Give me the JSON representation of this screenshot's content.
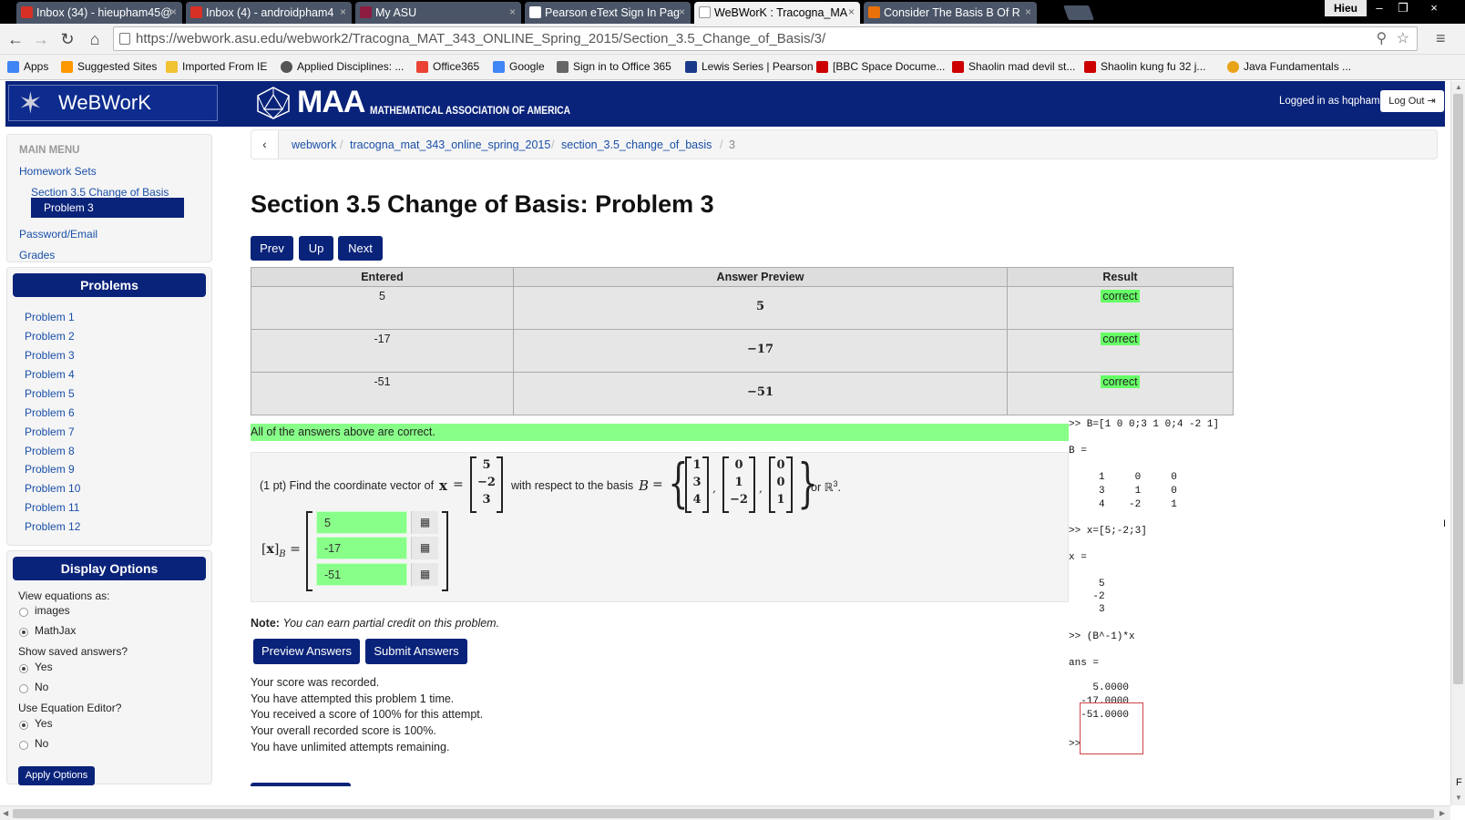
{
  "browser": {
    "tabs": [
      {
        "title": "Inbox (34) - hieupham45@",
        "favicon_color": "#d93025"
      },
      {
        "title": "Inbox (4) - androidpham4",
        "favicon_color": "#d93025"
      },
      {
        "title": "My ASU",
        "favicon_color": "#8c1d40"
      },
      {
        "title": "Pearson eText Sign In Pag",
        "favicon_color": "#ffffff"
      },
      {
        "title": "WeBWorK : Tracogna_MA",
        "favicon_color": "#ffffff"
      },
      {
        "title": "Consider The Basis B Of R",
        "favicon_color": "#e8710a"
      }
    ],
    "user": "Hieu",
    "url": "https://webwork.asu.edu/webwork2/Tracogna_MAT_343_ONLINE_Spring_2015/Section_3.5_Change_of_Basis/3/",
    "bookmarks": [
      {
        "label": "Apps",
        "color": "#4285f4"
      },
      {
        "label": "Suggested Sites",
        "color": "#ff9800"
      },
      {
        "label": "Imported From IE",
        "color": "#f1c232"
      },
      {
        "label": "Applied Disciplines: ...",
        "color": "#555555"
      },
      {
        "label": "Office365",
        "color": "#ea4335"
      },
      {
        "label": "Google",
        "color": "#4285f4"
      },
      {
        "label": "Sign in to Office 365",
        "color": "#666666"
      },
      {
        "label": "Lewis Series | Pearson",
        "color": "#1a3a8a"
      },
      {
        "label": "[BBC Space Docume...",
        "color": "#cc0000"
      },
      {
        "label": "Shaolin mad devil st...",
        "color": "#cc0000"
      },
      {
        "label": "Shaolin kung fu 32 j...",
        "color": "#cc0000"
      },
      {
        "label": "Java Fundamentals ...",
        "color": "#e8a317"
      }
    ]
  },
  "header": {
    "logo": "WeBWorK",
    "maa_big": "MAA",
    "maa_small": "MATHEMATICAL ASSOCIATION OF AMERICA",
    "logged_in": "Logged in as hqpham.",
    "logout": "Log Out"
  },
  "sidebar": {
    "main_menu_title": "MAIN MENU",
    "homework_sets": "Homework Sets",
    "section": "Section 3.5 Change of Basis",
    "current_problem": "Problem 3",
    "password_email": "Password/Email",
    "grades": "Grades",
    "problems_title": "Problems",
    "problems": [
      "Problem 1",
      "Problem 2",
      "Problem 3",
      "Problem 4",
      "Problem 5",
      "Problem 6",
      "Problem 7",
      "Problem 8",
      "Problem 9",
      "Problem 10",
      "Problem 11",
      "Problem 12"
    ],
    "display_options_title": "Display Options",
    "view_equations_label": "View equations as:",
    "opt_images": "images",
    "opt_mathjax": "MathJax",
    "show_saved_label": "Show saved answers?",
    "opt_yes": "Yes",
    "opt_no": "No",
    "use_editor_label": "Use Equation Editor?",
    "apply": "Apply Options"
  },
  "breadcrumb": [
    "webwork",
    "tracogna_mat_343_online_spring_2015",
    "section_3.5_change_of_basis",
    "3"
  ],
  "main": {
    "title": "Section 3.5 Change of Basis: Problem 3",
    "prev": "Prev",
    "up": "Up",
    "next": "Next",
    "table_headers": [
      "Entered",
      "Answer Preview",
      "Result"
    ],
    "rows": [
      {
        "entered": "5",
        "preview": "5",
        "result": "correct"
      },
      {
        "entered": "-17",
        "preview": "−17",
        "result": "correct"
      },
      {
        "entered": "-51",
        "preview": "−51",
        "result": "correct"
      }
    ],
    "all_correct": "All of the answers above are correct.",
    "problem_text_1": "(1 pt) Find the coordinate vector of",
    "bold_x": "x",
    "equals": "=",
    "x_vector": [
      "5",
      "−2",
      "3"
    ],
    "problem_text_2": "with respect to the basis",
    "basis_B": "B",
    "basis": [
      [
        "1",
        "3",
        "4"
      ],
      [
        "0",
        "1",
        "−2"
      ],
      [
        "0",
        "0",
        "1"
      ]
    ],
    "basis_suffix": "or ℝ",
    "basis_superscript": "3",
    "basis_period": ".",
    "coord_label_open": "[",
    "coord_label_close": "]",
    "coord_label_sub": "B",
    "answers": [
      "5",
      "-17",
      "-51"
    ],
    "note_label": "Note:",
    "note_text": "You can earn partial credit on this problem.",
    "preview_btn": "Preview Answers",
    "submit_btn": "Submit Answers",
    "status_lines": [
      "Your score was recorded.",
      "You have attempted this problem 1 time.",
      "You received a score of 100% for this attempt.",
      "Your overall recorded score is 100%.",
      "You have unlimited attempts remaining."
    ]
  },
  "console": {
    "lines": [
      ">> B=[1 0 0;3 1 0;4 -2 1]",
      "B =",
      "     1     0     0",
      "     3     1     0",
      "     4    -2     1",
      ">> x=[5;-2;3]",
      "x =",
      "     5",
      "    -2",
      "     3",
      ">> (B^-1)*x",
      "ans =",
      "    5.0000",
      "  -17.0000",
      "  -51.0000",
      ">>"
    ],
    "edge_glyph": "I",
    "edge_glyph_2": "F"
  },
  "icons": {
    "back": "←",
    "forward": "→",
    "reload": "↻",
    "home": "⌂",
    "close": "×",
    "grid": "▦",
    "star": "☆",
    "search": "⚲",
    "menu": "≡",
    "chevron_left": "‹",
    "logout_icon": "⇥"
  },
  "colors": {
    "brand": "#0a237a",
    "correct": "#66ff66",
    "link": "#1a4fa8"
  }
}
